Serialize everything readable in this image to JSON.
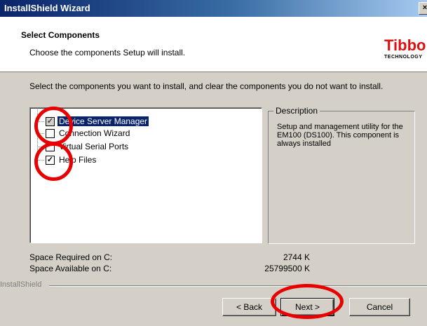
{
  "window": {
    "title": "InstallShield Wizard",
    "close_glyph": "×"
  },
  "header": {
    "title": "Select Components",
    "subtitle": "Choose the components Setup will install.",
    "logo_main": "Tibbo",
    "logo_sub": "TECHNOLOGY"
  },
  "body": {
    "instructions": "Select the components you want to install, and clear the components you do not want to install.",
    "components": [
      {
        "label": "Device Server Manager",
        "checked": true,
        "selected": true,
        "disabled": true
      },
      {
        "label": "Connection Wizard",
        "checked": false,
        "selected": false,
        "disabled": false
      },
      {
        "label": "Virtual Serial Ports",
        "checked": false,
        "selected": false,
        "disabled": false
      },
      {
        "label": "Help Files",
        "checked": true,
        "selected": false,
        "disabled": false
      }
    ],
    "description": {
      "legend": "Description",
      "text": "Setup and management utility for the EM100 (DS100). This component is always installed"
    },
    "space_required": {
      "label": "Space Required on  C:",
      "value": "2744 K"
    },
    "space_available": {
      "label": "Space Available on  C:",
      "value": "25799500 K"
    }
  },
  "footer": {
    "brand": "InstallShield",
    "back_label": "< Back",
    "next_label": "Next >",
    "cancel_label": "Cancel"
  },
  "colors": {
    "annotation": "#e80000",
    "logo": "#e01010",
    "selection": "#0a246a"
  }
}
